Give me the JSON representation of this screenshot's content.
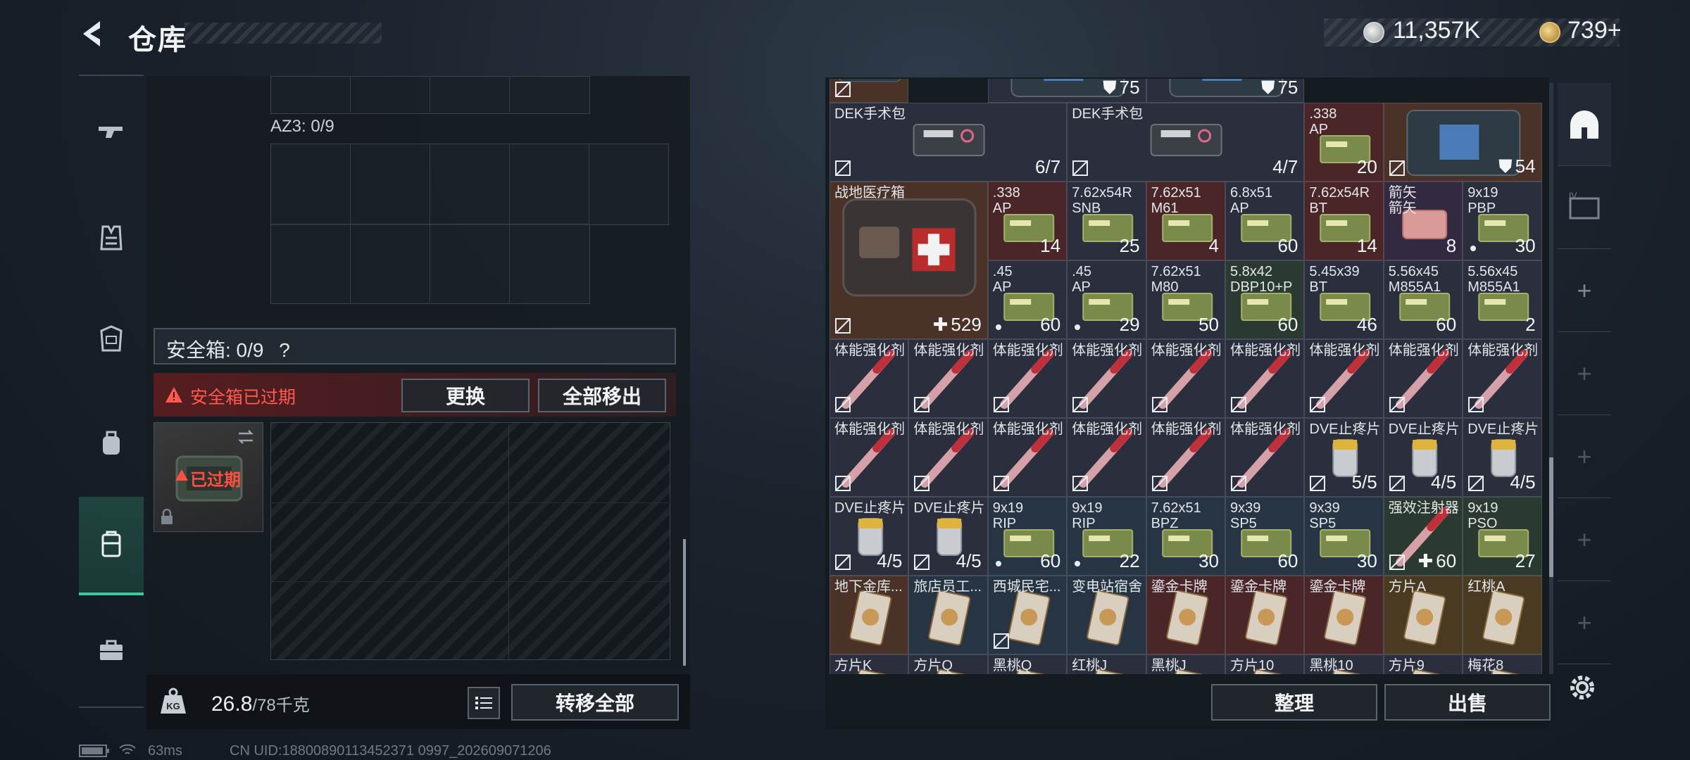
{
  "header": {
    "title": "仓库",
    "silver": "11,357K",
    "gold": "739+"
  },
  "left_nav": [
    "gun-icon",
    "vest-icon",
    "armor-icon",
    "backpack-icon",
    "case-icon",
    "briefcase-icon"
  ],
  "left_panel": {
    "az3_label": "AZ3: 0/9",
    "safe_box_label": "安全箱: 0/9",
    "help": "?",
    "expired_message": "安全箱已过期",
    "replace_button": "更换",
    "move_all_button": "全部移出",
    "case_status": "已过期",
    "weight_value": "26.8",
    "weight_capacity": "/78千克",
    "transfer_all_button": "转移全部"
  },
  "inventory": {
    "items": [
      {
        "name": "",
        "count": ""
      },
      {
        "name": "",
        "count": "75"
      },
      {
        "name": "",
        "count": "75"
      },
      {
        "name": "DEK手术包",
        "count": "6/7"
      },
      {
        "name": "DEK手术包",
        "count": "4/7"
      },
      {
        "name": ".338\nAP",
        "count": "20"
      },
      {
        "name": "",
        "count": "54"
      },
      {
        "name": "战地医疗箱",
        "count": "529"
      },
      {
        "name": ".338\nAP",
        "count": "14"
      },
      {
        "name": "7.62x54R\nSNB",
        "count": "25"
      },
      {
        "name": "7.62x51\nM61",
        "count": "4"
      },
      {
        "name": "6.8x51\nAP",
        "count": "60"
      },
      {
        "name": "7.62x54R\nBT",
        "count": "14"
      },
      {
        "name": "箭矢\n箭矢",
        "count": "8"
      },
      {
        "name": "9x19\nPBP",
        "count": "30"
      },
      {
        "name": ".45\nAP",
        "count": "60"
      },
      {
        "name": ".45\nAP",
        "count": "29"
      },
      {
        "name": "7.62x51\nM80",
        "count": "50"
      },
      {
        "name": "5.8x42\nDBP10+P",
        "count": "60"
      },
      {
        "name": "5.45x39\nBT",
        "count": "46"
      },
      {
        "name": "5.56x45\nM855A1",
        "count": "60"
      },
      {
        "name": "5.56x45\nM855A1",
        "count": "2"
      },
      {
        "name": "体能强化剂",
        "count": ""
      },
      {
        "name": "体能强化剂",
        "count": ""
      },
      {
        "name": "体能强化剂",
        "count": ""
      },
      {
        "name": "体能强化剂",
        "count": ""
      },
      {
        "name": "体能强化剂",
        "count": ""
      },
      {
        "name": "体能强化剂",
        "count": ""
      },
      {
        "name": "体能强化剂",
        "count": ""
      },
      {
        "name": "体能强化剂",
        "count": ""
      },
      {
        "name": "体能强化剂",
        "count": ""
      },
      {
        "name": "体能强化剂",
        "count": ""
      },
      {
        "name": "体能强化剂",
        "count": ""
      },
      {
        "name": "体能强化剂",
        "count": ""
      },
      {
        "name": "体能强化剂",
        "count": ""
      },
      {
        "name": "体能强化剂",
        "count": ""
      },
      {
        "name": "体能强化剂",
        "count": ""
      },
      {
        "name": "DVE止疼片",
        "count": "5/5"
      },
      {
        "name": "DVE止疼片",
        "count": "4/5"
      },
      {
        "name": "DVE止疼片",
        "count": "4/5"
      },
      {
        "name": "DVE止疼片",
        "count": "4/5"
      },
      {
        "name": "DVE止疼片",
        "count": "4/5"
      },
      {
        "name": "9x19\nRIP",
        "count": "60"
      },
      {
        "name": "9x19\nRIP",
        "count": "22"
      },
      {
        "name": "7.62x51\nBPZ",
        "count": "30"
      },
      {
        "name": "9x39\nSP5",
        "count": "60"
      },
      {
        "name": "9x39\nSP5",
        "count": "30"
      },
      {
        "name": "强效注射器",
        "count": "60"
      },
      {
        "name": "9x19\nPSO",
        "count": "27"
      },
      {
        "name": "地下金库...",
        "count": ""
      },
      {
        "name": "旅店员工...",
        "count": ""
      },
      {
        "name": "西城民宅...",
        "count": ""
      },
      {
        "name": "变电站宿舍",
        "count": ""
      },
      {
        "name": "鎏金卡牌",
        "count": ""
      },
      {
        "name": "鎏金卡牌",
        "count": ""
      },
      {
        "name": "鎏金卡牌",
        "count": ""
      },
      {
        "name": "方片A",
        "count": ""
      },
      {
        "name": "红桃A",
        "count": ""
      },
      {
        "name": "方片K",
        "count": ""
      },
      {
        "name": "方片Q",
        "count": ""
      },
      {
        "name": "黑桃Q",
        "count": ""
      },
      {
        "name": "红桃J",
        "count": ""
      },
      {
        "name": "黑桃J",
        "count": ""
      },
      {
        "name": "方片10",
        "count": ""
      },
      {
        "name": "黑桃10",
        "count": ""
      },
      {
        "name": "方片9",
        "count": ""
      },
      {
        "name": "梅花8",
        "count": ""
      }
    ],
    "sort_button": "整理",
    "sell_button": "出售"
  },
  "status_bar": {
    "ping": "63ms",
    "uid": "CN UID:18800890113452371 0997_202609071206"
  },
  "colors": {
    "accent_green": "#40c79a",
    "expired_red": "#ff5a4e"
  }
}
